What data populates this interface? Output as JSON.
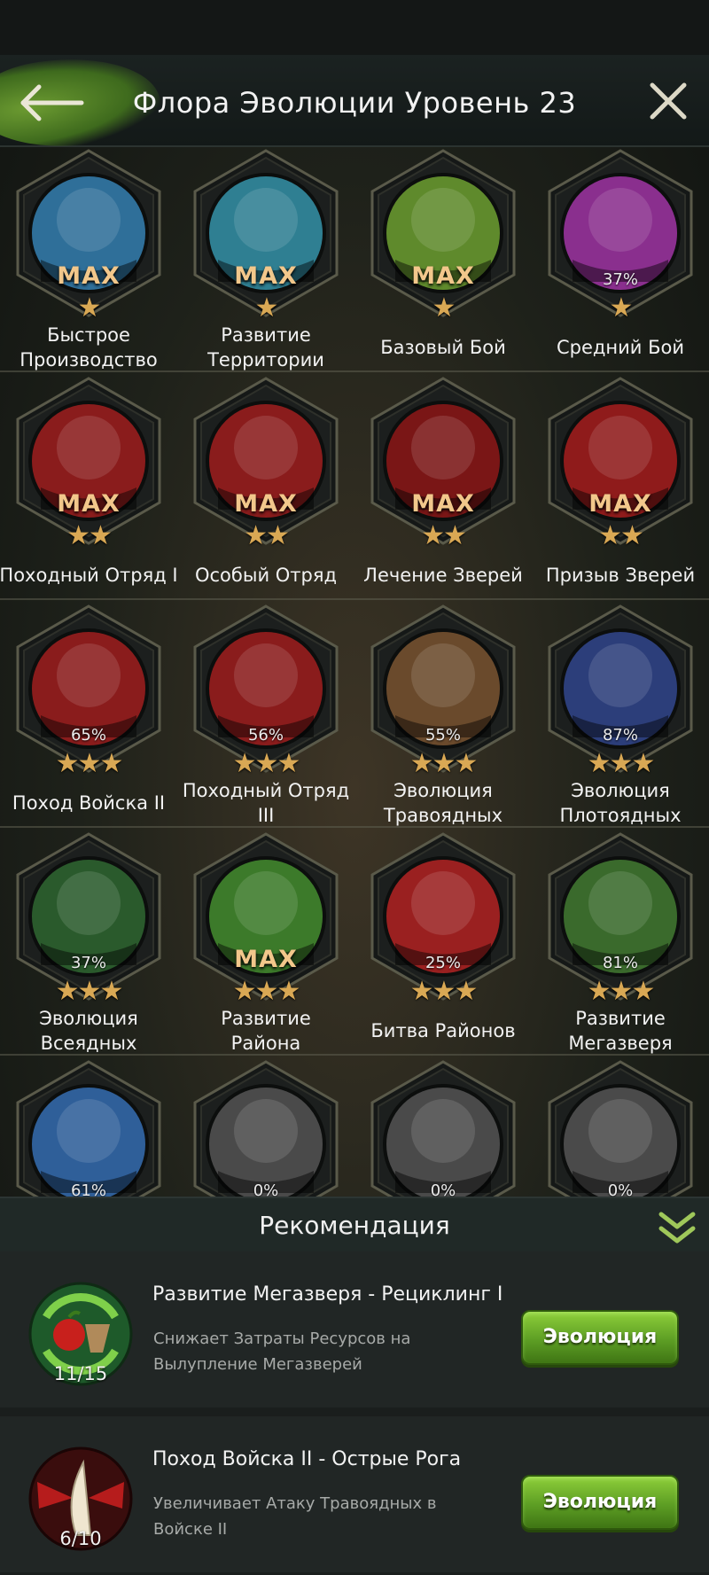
{
  "header": {
    "title": "Флора Эволюции Уровень 23"
  },
  "skills": [
    {
      "label": "Быстрое\nПроизводство",
      "level": "MAX",
      "stars": 1,
      "icon": "wood-stump-icon",
      "bg": "#2f6f99"
    },
    {
      "label": "Развитие\nТерритории",
      "level": "MAX",
      "stars": 1,
      "icon": "resources-icon",
      "bg": "#2f7f92"
    },
    {
      "label": "Базовый Бой",
      "level": "MAX",
      "stars": 1,
      "icon": "claw-icon",
      "bg": "#5f8a2c"
    },
    {
      "label": "Средний Бой",
      "level": "37%",
      "stars": 1,
      "icon": "claw-icon",
      "bg": "#8a2f8e"
    },
    {
      "label": "Походный Отряд I",
      "level": "MAX",
      "stars": 2,
      "icon": "beast-squad-icon",
      "bg": "#8a1c1c"
    },
    {
      "label": "Особый Отряд",
      "level": "MAX",
      "stars": 2,
      "icon": "beast-squad-icon",
      "bg": "#8a1c1c"
    },
    {
      "label": "Лечение Зверей",
      "level": "MAX",
      "stars": 2,
      "icon": "healing-drop-icon",
      "bg": "#7a1616"
    },
    {
      "label": "Призыв Зверей",
      "level": "MAX",
      "stars": 2,
      "icon": "howling-wolf-icon",
      "bg": "#8f1b1b"
    },
    {
      "label": "Поход Войска II",
      "level": "65%",
      "stars": 3,
      "icon": "beast-squad-icon",
      "bg": "#8a1c1c"
    },
    {
      "label": "Походный Отряд\nIII",
      "level": "56%",
      "stars": 3,
      "icon": "beast-squad-icon",
      "bg": "#8a1c1c"
    },
    {
      "label": "Эволюция\nТравоядных",
      "level": "55%",
      "stars": 3,
      "icon": "bison-icon",
      "bg": "#6a4a2c"
    },
    {
      "label": "Эволюция\nПлотоядных",
      "level": "87%",
      "stars": 3,
      "icon": "wolf-icon",
      "bg": "#2c3e7a"
    },
    {
      "label": "Эволюция\nВсеядных",
      "level": "37%",
      "stars": 3,
      "icon": "gorilla-icon",
      "bg": "#2a5a2c"
    },
    {
      "label": "Развитие\nРайона",
      "level": "MAX",
      "stars": 3,
      "icon": "wood-chunk-icon",
      "bg": "#3c7a2a"
    },
    {
      "label": "Битва Районов",
      "level": "25%",
      "stars": 3,
      "icon": "leopard-lightning-icon",
      "bg": "#9a2020"
    },
    {
      "label": "Развитие\nМегазверя",
      "level": "81%",
      "stars": 3,
      "icon": "dinosaur-icon",
      "bg": "#3a6a2c"
    },
    {
      "label": "",
      "level": "61%",
      "stars": 0,
      "icon": "claw-icon",
      "bg": "#2f5f99"
    },
    {
      "label": "",
      "level": "0%",
      "stars": 0,
      "icon": "bison-grey-icon",
      "bg": "#4a4a4a"
    },
    {
      "label": "",
      "level": "0%",
      "stars": 0,
      "icon": "wolf-grey-icon",
      "bg": "#4a4a4a"
    },
    {
      "label": "",
      "level": "0%",
      "stars": 0,
      "icon": "gorilla-grey-icon",
      "bg": "#4a4a4a"
    }
  ],
  "recommendation": {
    "title": "Рекомендация",
    "items": [
      {
        "title": "Развитие Мегазверя - Рециклинг I",
        "desc": "Снижает Затраты Ресурсов на Вылупление Мегазверей",
        "count": "11/15",
        "button": "Эволюция",
        "icon": "apple-recycle-icon"
      },
      {
        "title": "Поход Войска II - Острые Рога",
        "desc": "Увеличивает Атаку Травоядных в Войске II",
        "count": "6/10",
        "button": "Эволюция",
        "icon": "sharp-horn-icon"
      }
    ]
  },
  "colors": {
    "accent_green": "#6aa82c",
    "star_gold": "#d9a854",
    "max_text": "#f2c78b"
  }
}
